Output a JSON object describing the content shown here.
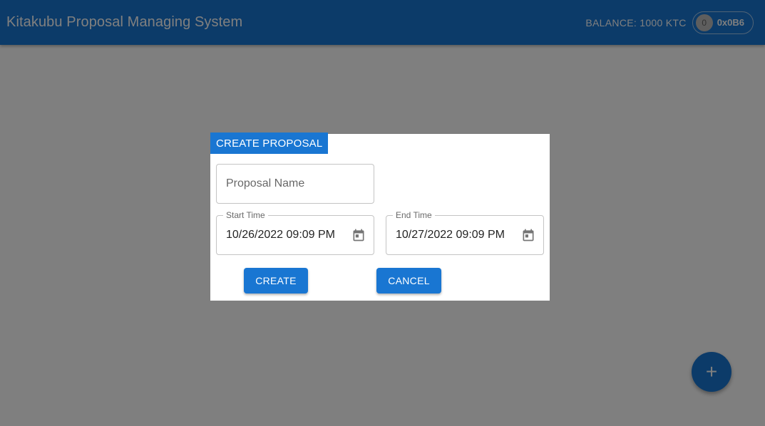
{
  "header": {
    "title": "Kitakubu Proposal Managing System",
    "balance": "BALANCE: 1000 KTC",
    "account": {
      "avatar_text": "0",
      "address": "0x0B6"
    }
  },
  "dialog": {
    "title": "CREATE PROPOSAL",
    "proposal_name": {
      "placeholder": "Proposal Name",
      "value": ""
    },
    "start_time": {
      "label": "Start Time",
      "value": "10/26/2022 09:09 PM"
    },
    "end_time": {
      "label": "End Time",
      "value": "10/27/2022 09:09 PM"
    },
    "create_label": "CREATE",
    "cancel_label": "CANCEL"
  },
  "fab": {
    "icon": "plus-icon",
    "glyph": "+"
  },
  "colors": {
    "primary": "#1976d2",
    "backdrop": "rgba(0,0,0,0.5)"
  }
}
